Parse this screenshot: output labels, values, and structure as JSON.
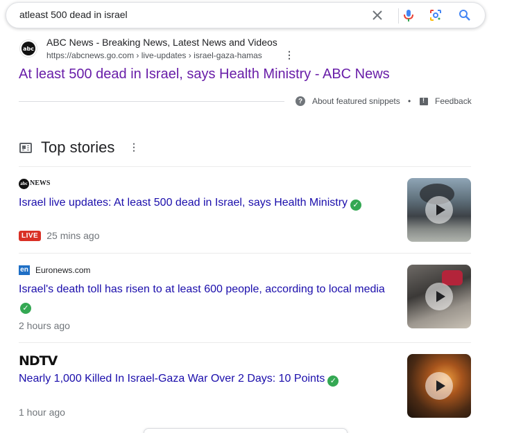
{
  "search": {
    "query": "atleast 500 dead in israel",
    "icons": [
      "close-icon",
      "mic-icon",
      "lens-icon",
      "search-icon"
    ]
  },
  "featured": {
    "site_name": "ABC News - Breaking News, Latest News and Videos",
    "url": "https://abcnews.go.com › live-updates › israel-gaza-hamas",
    "favicon_text": "abc",
    "title": "At least 500 dead in Israel, says Health Ministry - ABC News",
    "about_label": "About featured snippets",
    "separator": "•",
    "feedback_label": "Feedback"
  },
  "top_stories": {
    "heading": "Top stories",
    "stories": [
      {
        "source": "NEWS",
        "source_logo": "abc",
        "title": "Israel live updates: At least 500 dead in Israel, says Health Ministry",
        "badge": "LIVE",
        "time": "25 mins ago"
      },
      {
        "source": "Euronews.com",
        "source_logo": "en",
        "title": "Israel's death toll has risen to at least 600 people, according to local media",
        "time": "2 hours ago"
      },
      {
        "source": "NDTV",
        "title": "Nearly 1,000 Killed In Israel-Gaza War Over 2 Days: 10 Points",
        "time": "1 hour ago"
      }
    ]
  },
  "colors": {
    "link_visited": "#681da8",
    "link": "#1a0dab",
    "verified": "#34a853",
    "live_badge": "#d93025"
  }
}
